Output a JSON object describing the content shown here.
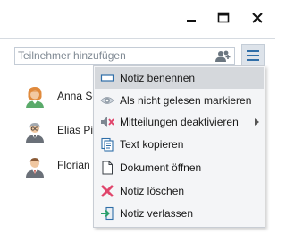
{
  "window": {
    "controls": [
      "minimize",
      "maximize",
      "close"
    ]
  },
  "search": {
    "placeholder": "Teilnehmer hinzufügen",
    "value": "",
    "add_icon": "add-user-icon"
  },
  "menu_button": {
    "icon": "hamburger-menu-icon"
  },
  "participants": [
    {
      "name": "Anna Schmidt",
      "avatar": "female-avatar-icon",
      "visible_name": "Anna Sc"
    },
    {
      "name": "Elias Pichler",
      "avatar": "male-avatar-icon",
      "visible_name": "Elias Pic"
    },
    {
      "name": "Florian L",
      "avatar": "male-avatar-icon",
      "visible_name": "Florian L"
    }
  ],
  "context_menu": {
    "items": [
      {
        "label": "Notiz benennen",
        "icon": "rename-icon",
        "highlighted": true
      },
      {
        "label": "Als nicht gelesen markieren",
        "icon": "eye-icon"
      },
      {
        "label": "Mitteilungen deaktivieren",
        "icon": "mute-speaker-icon",
        "submenu": true
      },
      {
        "label": "Text kopieren",
        "icon": "copy-icon"
      },
      {
        "label": "Dokument öffnen",
        "icon": "document-icon"
      },
      {
        "label": "Notiz löschen",
        "icon": "delete-icon"
      },
      {
        "label": "Notiz verlassen",
        "icon": "leave-icon"
      }
    ]
  },
  "colors": {
    "accent": "#2f6ea8",
    "highlight": "#d5d8dc",
    "delete": "#e0456b"
  }
}
